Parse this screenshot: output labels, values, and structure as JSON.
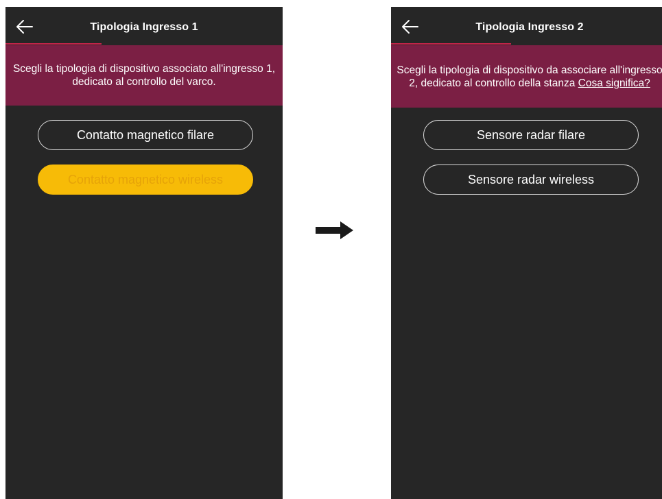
{
  "colors": {
    "phone_bg": "#262626",
    "banner_bg": "#7b1f44",
    "accent_selected": "#f7bb07",
    "tab_indicator": "#c8234a",
    "outline": "#dcdcdc"
  },
  "left_screen": {
    "title": "Tipologia Ingresso 1",
    "back_icon": "arrow-left-icon",
    "banner_text": "Scegli la tipologia di dispositivo associato all'ingresso 1, dedicato al controllo del varco.",
    "options": [
      {
        "label": "Contatto magnetico filare",
        "selected": false
      },
      {
        "label": "Contatto magnetico wireless",
        "selected": true
      }
    ]
  },
  "transition_icon": "arrow-right-icon",
  "right_screen": {
    "title": "Tipologia Ingresso 2",
    "back_icon": "arrow-left-icon",
    "banner_text": "Scegli la tipologia di dispositivo da associare all'ingresso 2, dedicato al controllo della stanza",
    "banner_link": "Cosa significa?",
    "options": [
      {
        "label": "Sensore radar filare",
        "selected": false
      },
      {
        "label": "Sensore radar wireless",
        "selected": false
      }
    ]
  }
}
